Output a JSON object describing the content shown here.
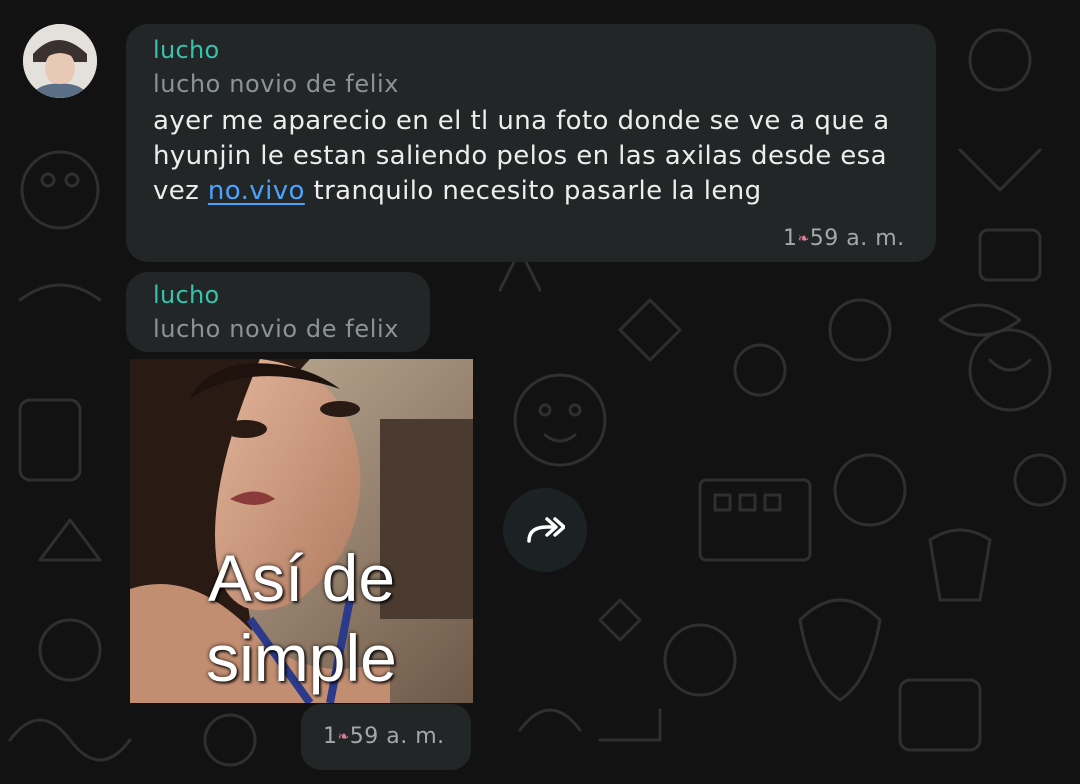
{
  "chat": {
    "messages": [
      {
        "sender": "lucho",
        "subtitle": "lucho novio de felix",
        "text_before": "ayer me aparecio en el tl una foto donde se ve a que a hyunjin le estan saliendo pelos en las axilas desde esa vez ",
        "link": "no.vivo",
        "text_after": " tranquilo necesito pasarle la leng",
        "time_prefix": "1",
        "time_suffix": "59 a. m."
      },
      {
        "sender": "lucho",
        "subtitle": "lucho novio de felix",
        "image": {
          "caption_line1": "Así de",
          "caption_line2": "simple"
        },
        "time_prefix": "1",
        "time_suffix": "59 a. m."
      }
    ],
    "time_separator_icon": "paw-icon",
    "forward_icon": "forward-arrow-icon"
  },
  "colors": {
    "background": "#121212",
    "bubble": "#232626",
    "sender": "#35c3ae",
    "link": "#4aa3ff",
    "secondary_text": "#8c9397"
  }
}
